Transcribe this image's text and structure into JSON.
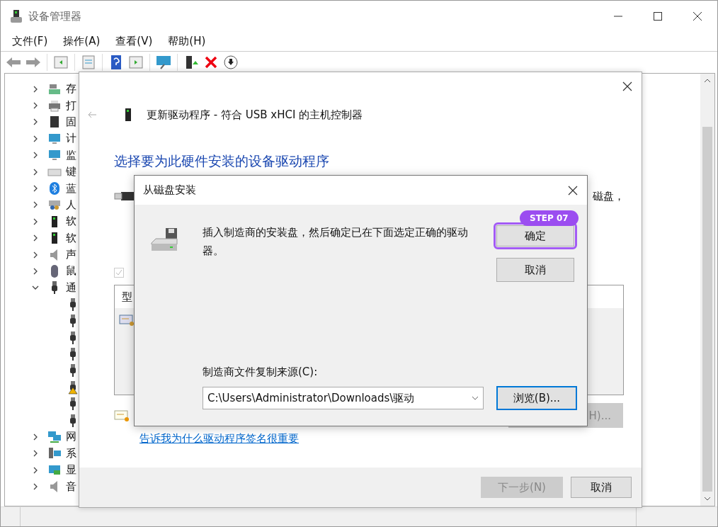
{
  "window": {
    "title": "设备管理器"
  },
  "menu": [
    "文件(F)",
    "操作(A)",
    "查看(V)",
    "帮助(H)"
  ],
  "tree": [
    {
      "label": "存",
      "expanded": false
    },
    {
      "label": "打",
      "expanded": false
    },
    {
      "label": "固",
      "expanded": false
    },
    {
      "label": "计",
      "expanded": false
    },
    {
      "label": "监",
      "expanded": false
    },
    {
      "label": "键",
      "expanded": false
    },
    {
      "label": "蓝",
      "expanded": false
    },
    {
      "label": "人",
      "expanded": false
    },
    {
      "label": "软",
      "expanded": false
    },
    {
      "label": "软",
      "expanded": false
    },
    {
      "label": "声",
      "expanded": false
    },
    {
      "label": "鼠",
      "expanded": false
    },
    {
      "label": "通",
      "expanded": true,
      "children": [
        {
          "warning": false
        },
        {
          "warning": false
        },
        {
          "warning": false
        },
        {
          "warning": false
        },
        {
          "warning": false
        },
        {
          "warning": true
        },
        {
          "warning": false
        },
        {
          "warning": false
        }
      ]
    },
    {
      "label": "网",
      "expanded": false
    },
    {
      "label": "系",
      "expanded": false
    },
    {
      "label": "显",
      "expanded": false
    },
    {
      "label": "音",
      "expanded": false
    }
  ],
  "wizard": {
    "title": "更新驱动程序 - 符合 USB xHCI 的主机控制器",
    "heading": "选择要为此硬件安装的设备驱动程序",
    "partial_text": "磁盘，",
    "checkbox": {
      "checked": true,
      "disabled": true
    },
    "list": {
      "column_1": "型"
    },
    "have_disk_button": {
      "label": "H)...",
      "disabled": true
    },
    "link": "告诉我为什么驱动程序签名很重要",
    "buttons": [
      {
        "label": "下一步(N)",
        "disabled": true
      },
      {
        "label": "取消",
        "disabled": false
      }
    ]
  },
  "disk_dialog": {
    "title": "从磁盘安装",
    "message": "插入制造商的安装盘，然后确定已在下面选定正确的驱动器。",
    "buttons": [
      {
        "label": "确定",
        "annotation": "STEP 07"
      },
      {
        "label": "取消"
      }
    ],
    "source_label": "制造商文件复制来源(C):",
    "source_value": "C:\\Users\\Administrator\\Downloads\\驱动",
    "browse_button": {
      "label": "浏览(B)...",
      "focused": true
    }
  }
}
